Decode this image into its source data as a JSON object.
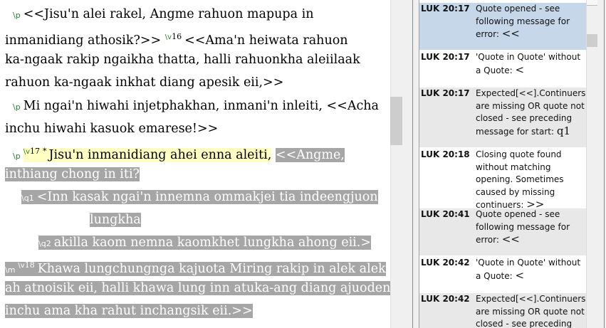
{
  "editor": {
    "l1": {
      "marker": "\\p",
      "text": "<<Jisu'n alei rakel, Angme rahuon mapupa in"
    },
    "l2": {
      "text": "inmanidiang athosik?>>",
      "vmarker": "\\v",
      "vnum": "16",
      "text2": "<<Ama'n heiwata rahuon"
    },
    "l3": {
      "text": "ka-ngaak rakip ngaikha thatta, halli rahuonkha aleiilaak"
    },
    "l4": {
      "text": "rahuon ka-ngaak inkhat diang apesik eii,>>"
    },
    "l5": {
      "marker": "\\p",
      "text": "Mi ngai'n hiwahi injetphakhan, inmani'n inleiti, <<Acha"
    },
    "l6": {
      "text": "inchu hiwahi kasuok emarese!>>"
    },
    "l7": {
      "marker": "\\p",
      "vmarker": "\\v",
      "vnum": "17",
      "asterisk": "*",
      "yellow_text": "Jisu'n inmanidiang ahei enna aleiti,",
      "sel_text": "<<Angme,"
    },
    "l8": {
      "text": "inthiang chong in iti?"
    },
    "l9": {
      "marker": "\\q1",
      "text": "<Inn kasak ngai'n innemna ommakjei tia indeengjuon"
    },
    "l10": {
      "text": "lungkha"
    },
    "l11": {
      "marker": "\\q2",
      "text": "akilla kaom nemna kaomkhet lungkha ahong eii.>"
    },
    "l12": {
      "marker": "\\m",
      "vmarker": "\\v",
      "vnum": "18",
      "text": "Khawa lungchungnga kajuota Miring rakip in alek alek"
    },
    "l13": {
      "text": "ah atnoisik eii, halli khawa lung inn atuka-ang diang ajuodeng"
    },
    "l14": {
      "text": "inchu ama kha rahut inchangsik eii.>>"
    }
  },
  "messages": [
    {
      "ref": "LUK 20:17",
      "text": "Quote opened - see following message for error:",
      "quote": "<<"
    },
    {
      "ref": "LUK 20:17",
      "text": "'Quote in Quote' without a Quote:",
      "quote": "<"
    },
    {
      "ref": "LUK 20:17",
      "text": "Expected[<<].Continuers are missing OR quote not closed - see preceding message for start:",
      "quote": "q1"
    },
    {
      "ref": "LUK 20:18",
      "text": "Closing quote found without matching opening. Sometimes caused by missing continuers:",
      "quote": ">>"
    },
    {
      "ref": "LUK 20:41",
      "text": "Quote opened - see following message for error:",
      "quote": "<<"
    },
    {
      "ref": "LUK 20:42",
      "text": "'Quote in Quote' without a Quote:",
      "quote": "<"
    },
    {
      "ref": "LUK 20:42",
      "text": "Expected[<<].Continuers are missing OR quote not closed - see preceding",
      "quote": ""
    }
  ],
  "colors": {
    "selection": "#a6a6a6",
    "highlight_yellow": "#ffffc4",
    "marker_green": "#2e7d32",
    "selected_message": "#c6d7ea"
  }
}
